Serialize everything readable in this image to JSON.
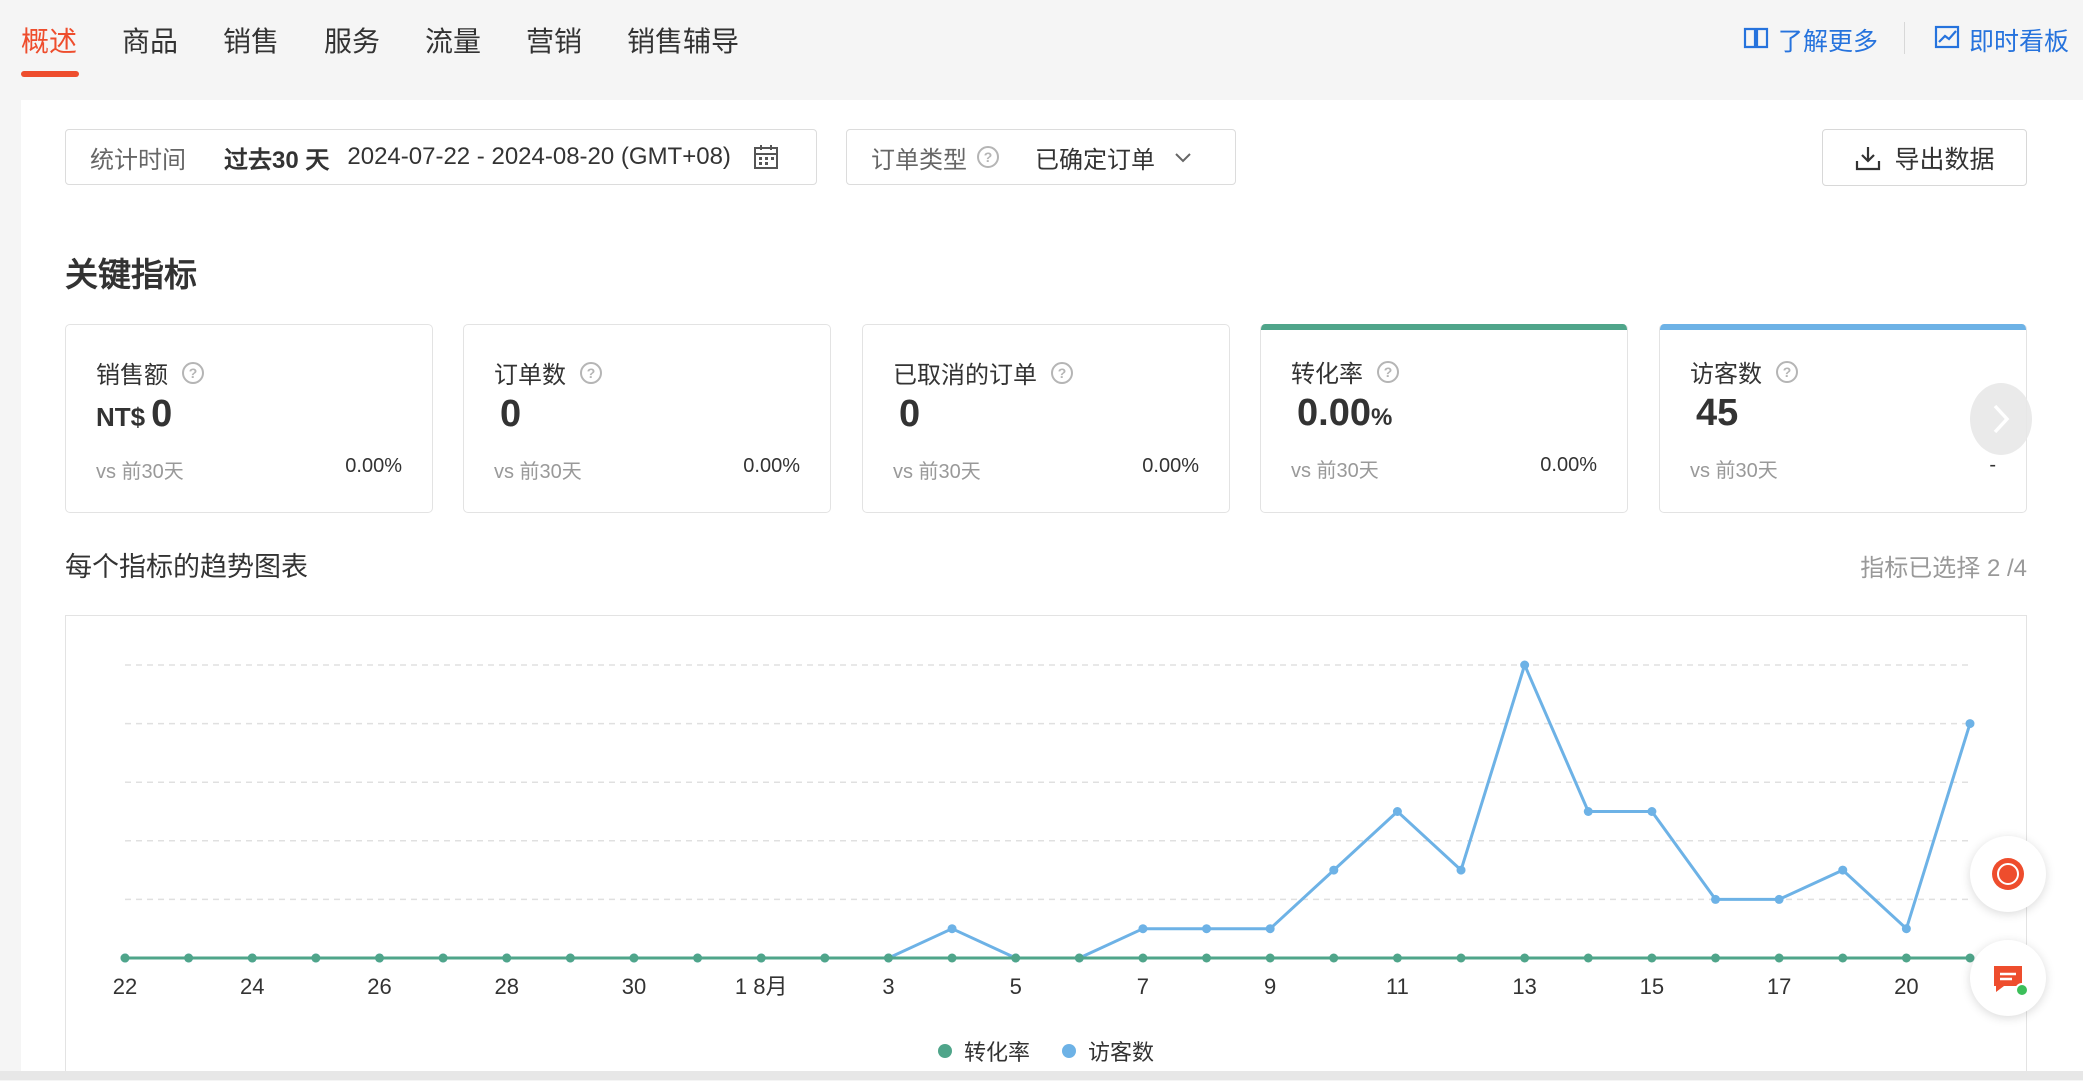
{
  "nav": {
    "tabs": [
      "概述",
      "商品",
      "销售",
      "服务",
      "流量",
      "营销",
      "销售辅导"
    ],
    "learn_more": "了解更多",
    "realtime": "即时看板"
  },
  "filters": {
    "time_label": "统计时间",
    "time_range": "过去30 天",
    "time_dates": "2024-07-22 - 2024-08-20 (GMT+08)",
    "order_type_label": "订单类型",
    "order_type_value": "已确定订单",
    "export_label": "导出数据"
  },
  "key_metrics": {
    "title": "关键指标",
    "cards": [
      {
        "title": "销售额",
        "currency": "NT$",
        "value": "0",
        "unit": "",
        "compare": "vs 前30天",
        "change": "0.00%",
        "accent": ""
      },
      {
        "title": "订单数",
        "currency": "",
        "value": "0",
        "unit": "",
        "compare": "vs 前30天",
        "change": "0.00%",
        "accent": ""
      },
      {
        "title": "已取消的订单",
        "currency": "",
        "value": "0",
        "unit": "",
        "compare": "vs 前30天",
        "change": "0.00%",
        "accent": ""
      },
      {
        "title": "转化率",
        "currency": "",
        "value": "0.00",
        "unit": "%",
        "compare": "vs 前30天",
        "change": "0.00%",
        "accent": "#4fa58a"
      },
      {
        "title": "访客数",
        "currency": "",
        "value": "45",
        "unit": "",
        "compare": "vs 前30天",
        "change": "-",
        "accent": "#6db2e6"
      }
    ]
  },
  "trend": {
    "title": "每个指标的趋势图表",
    "selected": "指标已选择 2 /4"
  },
  "colors": {
    "accent": "#ee4d2d",
    "link": "#2673dd",
    "conversion": "#4fa58a",
    "visitors": "#6db2e6"
  },
  "chart_data": {
    "type": "line",
    "x_tick_labels": [
      "22",
      "24",
      "26",
      "28",
      "30",
      "1 8月",
      "3",
      "5",
      "7",
      "9",
      "11",
      "13",
      "15",
      "17",
      "20"
    ],
    "x": [
      "7/22",
      "7/23",
      "7/24",
      "7/25",
      "7/26",
      "7/27",
      "7/28",
      "7/29",
      "7/30",
      "7/31",
      "8/1",
      "8/2",
      "8/3",
      "8/4",
      "8/5",
      "8/6",
      "8/7",
      "8/8",
      "8/9",
      "8/10",
      "8/11",
      "8/12",
      "8/13",
      "8/14",
      "8/15",
      "8/16",
      "8/17",
      "8/18",
      "8/19",
      "8/20"
    ],
    "series": [
      {
        "name": "转化率",
        "color": "#4fa58a",
        "values": [
          0,
          0,
          0,
          0,
          0,
          0,
          0,
          0,
          0,
          0,
          0,
          0,
          0,
          0,
          0,
          0,
          0,
          0,
          0,
          0,
          0,
          0,
          0,
          0,
          0,
          0,
          0,
          0,
          0,
          0
        ]
      },
      {
        "name": "访客数",
        "color": "#6db2e6",
        "values": [
          0,
          0,
          0,
          0,
          0,
          0,
          0,
          0,
          0,
          0,
          0,
          0,
          0,
          1,
          0,
          0,
          1,
          1,
          1,
          3,
          5,
          3,
          10,
          5,
          5,
          2,
          2,
          3,
          1,
          8
        ]
      }
    ],
    "ylim": [
      0,
      10
    ],
    "grid": true,
    "legend": "bottom-center"
  }
}
